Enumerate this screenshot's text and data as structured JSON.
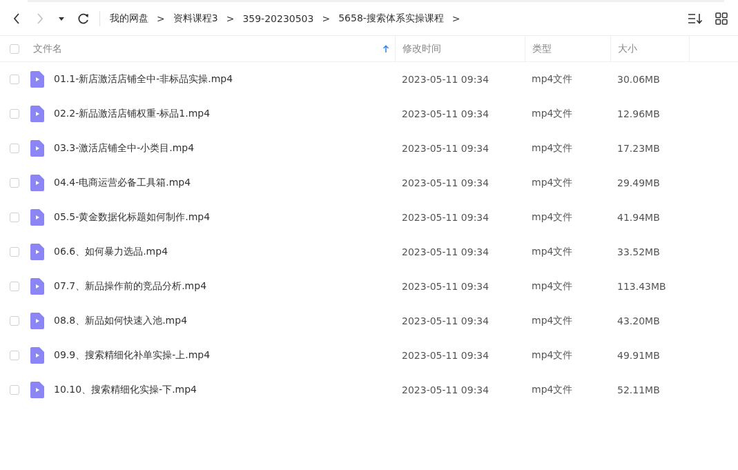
{
  "toolbar": {
    "nav": [
      {
        "kind": "back",
        "disabled": false
      },
      {
        "kind": "forward",
        "disabled": true
      },
      {
        "kind": "dropdown",
        "disabled": false
      },
      {
        "kind": "refresh",
        "disabled": false
      }
    ],
    "breadcrumb": [
      {
        "label": "我的网盘",
        "separator": ">"
      },
      {
        "label": "资料课程3",
        "separator": ">"
      },
      {
        "label": "359-20230503",
        "separator": ">"
      },
      {
        "label": "5658-搜索体系实操课程",
        "separator": ">"
      }
    ]
  },
  "table": {
    "select_all": {
      "checked": false
    },
    "columns": [
      "文件名",
      "修改时间",
      "类型",
      "大小"
    ],
    "rows": [
      {
        "checked": false,
        "name": "01.1-新店激活店铺全中-非标品实操.mp4",
        "modified": "2023-05-11 09:34",
        "type": "mp4文件",
        "size": "30.06MB"
      },
      {
        "checked": false,
        "name": "02.2-新品激活店铺权重-标品1.mp4",
        "modified": "2023-05-11 09:34",
        "type": "mp4文件",
        "size": "12.96MB"
      },
      {
        "checked": false,
        "name": "03.3-激活店铺全中-小类目.mp4",
        "modified": "2023-05-11 09:34",
        "type": "mp4文件",
        "size": "17.23MB"
      },
      {
        "checked": false,
        "name": "04.4-电商运营必备工具箱.mp4",
        "modified": "2023-05-11 09:34",
        "type": "mp4文件",
        "size": "29.49MB"
      },
      {
        "checked": false,
        "name": "05.5-黄金数据化标题如何制作.mp4",
        "modified": "2023-05-11 09:34",
        "type": "mp4文件",
        "size": "41.94MB"
      },
      {
        "checked": false,
        "name": "06.6、如何暴力选品.mp4",
        "modified": "2023-05-11 09:34",
        "type": "mp4文件",
        "size": "33.52MB"
      },
      {
        "checked": false,
        "name": "07.7、新品操作前的竞品分析.mp4",
        "modified": "2023-05-11 09:34",
        "type": "mp4文件",
        "size": "113.43MB"
      },
      {
        "checked": false,
        "name": "08.8、新品如何快速入池.mp4",
        "modified": "2023-05-11 09:34",
        "type": "mp4文件",
        "size": "43.20MB"
      },
      {
        "checked": false,
        "name": "09.9、搜索精细化补单实操-上.mp4",
        "modified": "2023-05-11 09:34",
        "type": "mp4文件",
        "size": "49.91MB"
      },
      {
        "checked": false,
        "name": "10.10、搜索精细化实操-下.mp4",
        "modified": "2023-05-11 09:34",
        "type": "mp4文件",
        "size": "52.11MB"
      }
    ]
  }
}
